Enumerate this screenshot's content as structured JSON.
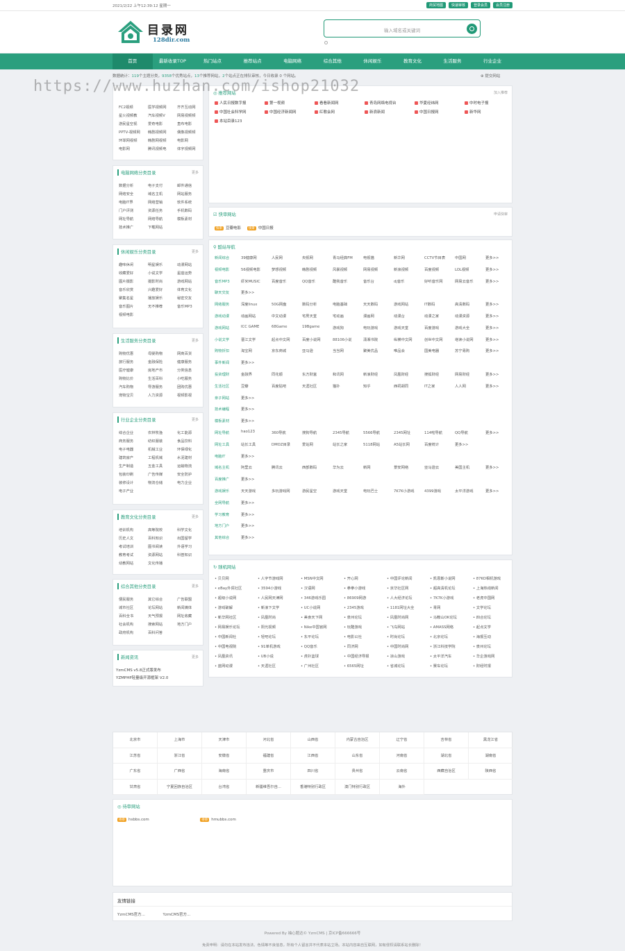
{
  "topbar": {
    "date": "2021/2/22 上午12:39:12 星期一",
    "links": [
      "商贸地图",
      "快速审核",
      "登录会员",
      "会员注册"
    ]
  },
  "brand": {
    "name": "目录网",
    "domain": "128dir.com"
  },
  "search": {
    "placeholder": "输入域名或关键词"
  },
  "nav": [
    "首页",
    "最新收录TOP",
    "热门站点",
    "推荐站点",
    "电脑网络",
    "综合其他",
    "休闲娱乐",
    "教育文化",
    "生活服务",
    "行业企业"
  ],
  "stats": {
    "prefix": "数据统计：",
    "cats": "119",
    "t1": "个主题分类，",
    "sites": "9358",
    "t2": "个优秀站点，",
    "rec": "13",
    "t3": "个推荐网站，",
    "wait": "2",
    "t4": "个站点正在排队审核，",
    "today": "今日收录 0 个网站。",
    "submit": "提交网站"
  },
  "watermark": "https://www.huzhan.com/ishop21032",
  "leftcards": [
    {
      "title": "",
      "items": [
        "FC2视频",
        "医学视频网",
        "齐齐互动网",
        "星火视频教",
        "汽车视频V",
        "网易视频频",
        "游民星空视",
        "爱奇电影",
        "直布电影",
        "PPTV-视频网",
        "韩剧视频网",
        "偶像视频频",
        "环球网视频",
        "韩剧网视频",
        "电影网",
        "电影网",
        "腾讯视频电",
        "体字视频网"
      ]
    },
    {
      "title": "电脑网络分类目录",
      "more": "更多",
      "items": [
        "数据分析",
        "电子支付",
        "邮件通信",
        "网络安全",
        "域名主机",
        "网站服务",
        "电脑IT界",
        "网络营销",
        "软件系统",
        "门户评测",
        "资源任务",
        "手机数码",
        "网址导航",
        "网络导航",
        "模板素材",
        "技术推广",
        "下载网站"
      ]
    },
    {
      "title": "休闲娱乐分类目录",
      "more": "更多",
      "items": [
        "趣味休闲",
        "明星娱乐",
        "动漫网站",
        "收藏爱好",
        "小说文学",
        "星座运势",
        "图片摄影",
        "摄影时尚",
        "游戏网站",
        "音乐欣赏",
        "兴趣爱好",
        "体育文化",
        "聚集名星",
        "播放娱乐",
        "秘密交友",
        "音乐图片",
        "无不推荐",
        "音乐MP3",
        "视频电影"
      ]
    },
    {
      "title": "生活服务分类目录",
      "more": "更多",
      "items": [
        "购物优惠",
        "母婴购物",
        "网商百货",
        "旅行服务",
        "金融保险",
        "健康服务",
        "医疗健康",
        "房地产市",
        "分类信息",
        "购物比价",
        "生活百科",
        "小吃服务",
        "汽车购物",
        "导游服务",
        "团购优惠",
        "宠物宝贝",
        "人力资源",
        "视频影视"
      ]
    },
    {
      "title": "行业企业分类目录",
      "more": "更多",
      "items": [
        "综合企业",
        "农林牧渔",
        "化工能源",
        "商务服务",
        "纺织服装",
        "食品饮料",
        "电子电器",
        "机械工业",
        "环保绿化",
        "建筑房产",
        "工程机械",
        "水泥建材",
        "生产制造",
        "五金工具",
        "运输物流",
        "包装印刷",
        "广告传媒",
        "安全防护",
        "装修设计",
        "物流仓储",
        "电力企业",
        "电子产业"
      ]
    },
    {
      "title": "教育文化分类目录",
      "more": "更多",
      "items": [
        "培训机构",
        "高等院校",
        "科学文化",
        "历史人文",
        "百科知识",
        "出国留学",
        "考试培训",
        "图书阅读",
        "外语学习",
        "教育考试",
        "资源网站",
        "科普知识",
        "幼教网站",
        "文化传播"
      ]
    },
    {
      "title": "综合其他分类目录",
      "more": "更多",
      "items": [
        "便民服务",
        "其它综合",
        "广告联盟",
        "城市社区",
        "论坛网站",
        "新闻媒体",
        "百科全书",
        "天气预报",
        "网址收藏",
        "社会机构",
        "搜索网站",
        "地方门户",
        "政府机构",
        "百科问答"
      ]
    },
    {
      "title": "新闻资讯",
      "more": "更多",
      "items": [
        "YzmCMS v5.8正式版发布",
        "YZMPHP轻量级开源框架 V2.0"
      ]
    }
  ],
  "recommend": {
    "title": "推荐网站",
    "more": "加入推荐",
    "items": [
      "人民日报数字报",
      "第一视频",
      "看看新闻网",
      "青岛网络电视台",
      "华夏经纬网",
      "中时电子报",
      "中国社会科学网",
      "中国经济新闻网",
      "红歌会网",
      "新浪新闻",
      "中国日报网",
      "新华网",
      "本站目录123"
    ]
  },
  "quick": {
    "title": "快审网站",
    "more": "申请快审",
    "items": [
      "豆瓣电影",
      "中国日报"
    ]
  },
  "nav2": {
    "title": "酷站导航",
    "rows": [
      [
        "新闻综合",
        "39健康网",
        "人民网",
        "央视网",
        "青马经典FM",
        "电视猫",
        "新华网",
        "CCTV节目表",
        "中国网",
        "更多>>"
      ],
      [
        "视频电影",
        "56视频电影",
        "梦想视频",
        "韩剧视频",
        "风暴视频",
        "网易视频",
        "新浪视频",
        "百度视频",
        "LOL视频",
        "更多>>"
      ],
      [
        "音乐MP3",
        "虾米MUSIC",
        "百度音乐",
        "QQ音乐",
        "酷我音乐",
        "音乐台",
        "dj音乐",
        "好听音乐网",
        "网易云音乐",
        "更多>>"
      ],
      [
        "聊天交友",
        "更多>>"
      ],
      [
        "网络服务",
        "深度linux",
        "50G网盘",
        "数码分析",
        "电脑基础",
        "天天数码",
        "游戏网站",
        "IT数码",
        "高清数码",
        "更多>>"
      ],
      [
        "游戏动漫",
        "动画网站",
        "中文动漫",
        "宅男天堂",
        "宅动画",
        "漫画网",
        "动漫台",
        "动漫之家",
        "动漫资源",
        "更多>>"
      ],
      [
        "游戏网站",
        "ICC GAME",
        "68Game",
        "19Bgame",
        "游戏狗",
        "电玩游戏",
        "游戏天堂",
        "百度游戏",
        "游戏大全",
        "更多>>"
      ],
      [
        "小说文学",
        "晋江文学",
        "起点中文网",
        "百度小说网",
        "88106小说",
        "潇湘书院",
        "纵横中文网",
        "创世中文网",
        "塔读小说网",
        "更多>>"
      ],
      [
        "购物折扣",
        "淘宝网",
        "京东商城",
        "亚马逊",
        "当当网",
        "聚美优品",
        "唯品会",
        "国美电器",
        "苏宁易购",
        "更多>>"
      ],
      [
        "事件新闻",
        "更多>>"
      ],
      [
        "投资理财",
        "金融界",
        "同花顺",
        "东方财富",
        "和讯网",
        "新浪财经",
        "凤凰财经",
        "搜狐财经",
        "网易财经",
        "更多>>"
      ],
      [
        "生活社区",
        "豆瓣",
        "百度贴吧",
        "天涯社区",
        "猫扑",
        "知乎",
        "西祠胡同",
        "IT之家",
        "人人网",
        "更多>>"
      ],
      [
        "亲子网站",
        "更多>>"
      ],
      [
        "技术编程",
        "更多>>"
      ],
      [
        "模板素材",
        "更多>>"
      ],
      [
        "网址导航",
        "hao123",
        "360导航",
        "搜狗导航",
        "2345导航",
        "5566导航",
        "2345网址",
        "114啦导航",
        "QQ导航",
        "更多>>"
      ],
      [
        "网址工具",
        "站长工具",
        "DMOZ目录",
        "爱站网",
        "站长之家",
        "5118网站",
        "A5站长网",
        "百度统计",
        "更多>>"
      ],
      [
        "电脑IT",
        "更多>>"
      ],
      [
        "域名主机",
        "阿里云",
        "腾讯云",
        "西部数码",
        "华为云",
        "新网",
        "景安网络",
        "亚马逊云",
        "美国主机",
        "更多>>"
      ],
      [
        "百度推广",
        "更多>>"
      ],
      [
        "游戏娱乐",
        "天天游戏",
        "多玩游戏网",
        "游民星空",
        "游戏天堂",
        "电玩巴士",
        "7K7K小游戏",
        "4399游戏",
        "太平洋游戏",
        "更多>>"
      ],
      [
        "全网导航",
        "更多>>"
      ],
      [
        "学习教育",
        "更多>>"
      ],
      [
        "地方门户",
        "更多>>"
      ],
      [
        "其他综合",
        "更多>>"
      ]
    ]
  },
  "random": {
    "title": "随机网站",
    "items": [
      "贝贝网",
      "人字节游戏网",
      "MSN中文网",
      "开心网",
      "中国评论新闻",
      "凯恩斯小说网",
      "87KO相机游戏",
      "eBay外贸社区",
      "3594小游戏",
      "汉语网",
      "拳拳小游戏",
      "京华社区网",
      "超高清机论坛",
      "上海热线新闻",
      "超级小说网",
      "人民网天津网",
      "346游戏乐园",
      "86909网游",
      "人大经济论坛",
      "7K7K小游戏",
      "老虎中国网",
      "游戏破解",
      "新浪下文学",
      "UC小说网",
      "2345游戏",
      "1181网址大全",
      "青网",
      "文学论坛",
      "新华网社区",
      "凤凰时尚",
      "美食天下网",
      "泉州论坛",
      "凤凰时尚网",
      "马鞍山OK论坛",
      "四合论坛",
      "网易娱乐论坛",
      "阳光视频",
      "Nike中国官网",
      "玩酷游戏",
      "飞鸟网站",
      "AMASS网络",
      "起点文学",
      "中国新闻社",
      "轻吧论坛",
      "东平论坛",
      "电影公社",
      "时尚论坛",
      "北京论坛",
      "海报互动",
      "中国电视院",
      "91单机游戏",
      "QQ音乐",
      "同济网",
      "中国时尚网",
      "浙江科技学院",
      "泉州论坛",
      "凤凰资讯",
      "UB小说",
      "虎扑篮球",
      "中国经济导报",
      "凉山游戏",
      "太平洋汽车",
      "华企游戏网",
      "蓝网动漫",
      "天涯社区",
      "广州社区",
      "6565网址",
      "省城论坛",
      "赛车论坛",
      "财经时报"
    ]
  },
  "provinces": [
    "北京市",
    "上海市",
    "天津市",
    "河北省",
    "山西省",
    "内蒙古自治区",
    "辽宁省",
    "吉林省",
    "黑龙江省",
    "江苏省",
    "浙江省",
    "安徽省",
    "福建省",
    "江西省",
    "山东省",
    "河南省",
    "湖北省",
    "湖南省",
    "广东省",
    "广西省",
    "海南省",
    "重庆市",
    "四川省",
    "贵州省",
    "云南省",
    "西藏自治区",
    "陕西省",
    "甘肃省",
    "宁夏回族自治区",
    "台湾省",
    "新疆维吾尔自...",
    "香港特别行政区",
    "澳门特别行政区",
    "海外"
  ],
  "pending": {
    "title": "待审网站",
    "badge": "待审",
    "items": [
      "hsbbs.com",
      "hmubbs.com"
    ]
  },
  "friend": {
    "title": "友情链接",
    "items": [
      "YzmCMS官方...",
      "YzmCMS官方..."
    ]
  },
  "footer": {
    "power": "Powered By 袖心题达© YzmCMS | 京ICP备666666号",
    "notice": "免责申明：请勿在本站发布违法、色情等不良信息，所有个人留言并不代表本站立场。本站内容来自互联网，如有侵权请联系站长删除！"
  },
  "colors": {
    "brand": "#2a9f7e",
    "bg": "#eef0f3"
  }
}
